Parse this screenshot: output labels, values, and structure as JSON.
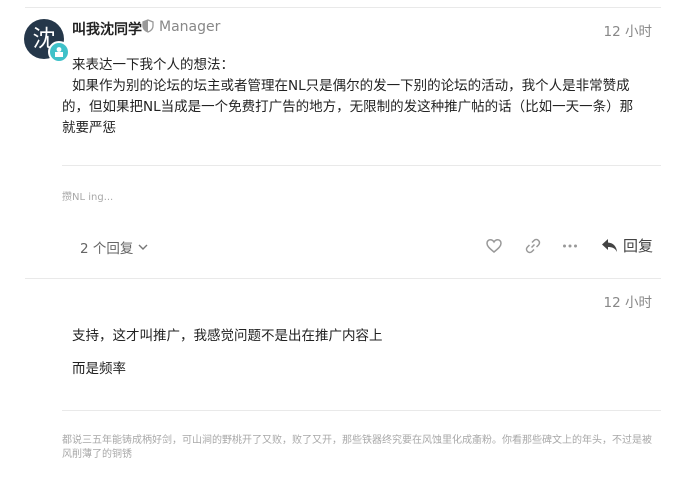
{
  "post1": {
    "avatar_char": "沈",
    "username": "叫我沈同学",
    "role": "Manager",
    "time": "12 小时",
    "lines": [
      "来表达一下我个人的想法：",
      "如果作为别的论坛的坛主或者管理在NL只是偶尔的发一下别的论坛的活动，我个人是非常赞成",
      "的，但如果把NL当成是一个免费打广告的地方，无限制的发这种推广帖的话（比如一天一条）那",
      "就要严惩"
    ],
    "signature": "攒NL ing...",
    "replies_label": "2 个回复",
    "reply_label": "回复"
  },
  "post2": {
    "time": "12 小时",
    "lines": [
      "支持，这才叫推广，我感觉问题不是出在推广内容上",
      "而是频率"
    ],
    "signature": [
      "都说三五年能铸成柄好剑，可山涧的野桃开了又败，败了又开，那些铁器终究要在风蚀里化成齑粉。你看那些碑文上的年头，不过是被",
      "风削薄了的铜锈"
    ]
  },
  "colors": {
    "badge": "#3fc1c9",
    "avatar": "#25374a"
  }
}
